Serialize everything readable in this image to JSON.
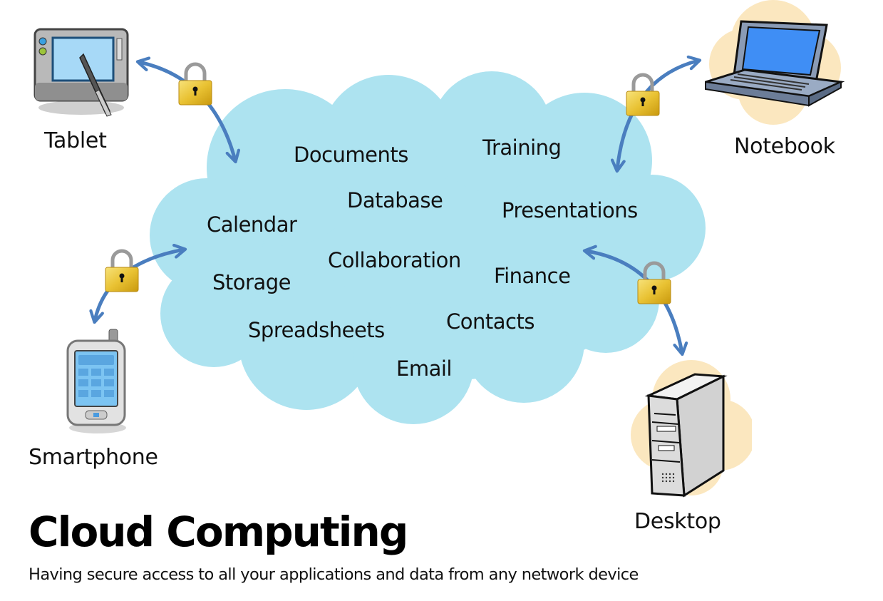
{
  "diagram": {
    "title": "Cloud Computing",
    "subtitle": "Having secure access to all your applications and data from any network device",
    "cloud": {
      "color": "#ade3f0",
      "services": [
        {
          "id": "documents",
          "label": "Documents"
        },
        {
          "id": "training",
          "label": "Training"
        },
        {
          "id": "database",
          "label": "Database"
        },
        {
          "id": "presentations",
          "label": "Presentations"
        },
        {
          "id": "calendar",
          "label": "Calendar"
        },
        {
          "id": "collaboration",
          "label": "Collaboration"
        },
        {
          "id": "finance",
          "label": "Finance"
        },
        {
          "id": "storage",
          "label": "Storage"
        },
        {
          "id": "contacts",
          "label": "Contacts"
        },
        {
          "id": "spreadsheets",
          "label": "Spreadsheets"
        },
        {
          "id": "email",
          "label": "Email"
        }
      ]
    },
    "devices": [
      {
        "id": "tablet",
        "label": "Tablet",
        "icon": "tablet-icon",
        "secured": true
      },
      {
        "id": "notebook",
        "label": "Notebook",
        "icon": "laptop-icon",
        "secured": true
      },
      {
        "id": "smartphone",
        "label": "Smartphone",
        "icon": "smartphone-icon",
        "secured": true
      },
      {
        "id": "desktop",
        "label": "Desktop",
        "icon": "desktop-tower-icon",
        "secured": true
      }
    ],
    "connection": {
      "type": "bidirectional",
      "arrow_color": "#4a7ebf",
      "lock_icon": "padlock-icon",
      "lock_color": "#e8c33a"
    }
  }
}
